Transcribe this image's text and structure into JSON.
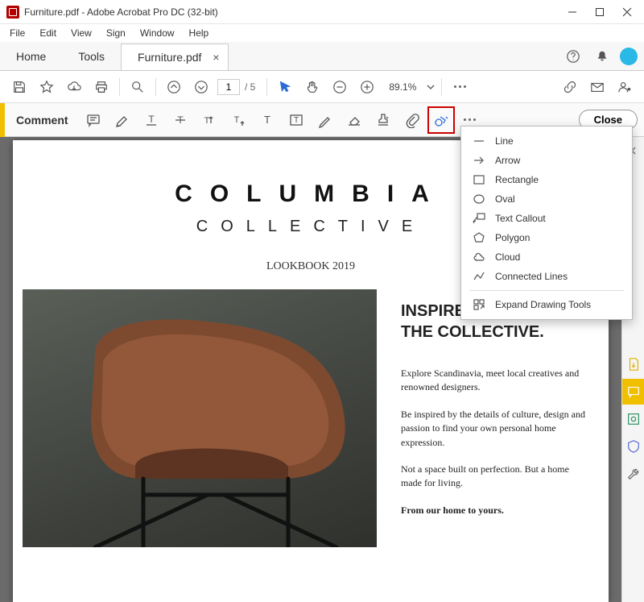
{
  "window": {
    "title": "Furniture.pdf - Adobe Acrobat Pro DC (32-bit)"
  },
  "menu": {
    "items": [
      "File",
      "Edit",
      "View",
      "Sign",
      "Window",
      "Help"
    ]
  },
  "tabs": {
    "home": "Home",
    "tools": "Tools",
    "doc": "Furniture.pdf"
  },
  "toolbar": {
    "page_current": "1",
    "page_total": "/ 5",
    "zoom": "89.1%"
  },
  "commentbar": {
    "label": "Comment",
    "close": "Close"
  },
  "dropdown": {
    "items": [
      "Line",
      "Arrow",
      "Rectangle",
      "Oval",
      "Text Callout",
      "Polygon",
      "Cloud",
      "Connected Lines"
    ],
    "expand": "Expand Drawing Tools"
  },
  "doc": {
    "brand": "COLUMBIA",
    "sub": "COLLECTIVE",
    "look": "LOOKBOOK 2019",
    "h_a": "INSPIRED BY",
    "h_b": "THE COLLECTIVE.",
    "p1": "Explore Scandinavia, meet local creatives and renowned designers.",
    "p2": "Be inspired by the details of culture, design and passion to find your own personal home expression.",
    "p3": "Not a space built on perfection. But a home made for living.",
    "p4": "From our home to yours."
  }
}
